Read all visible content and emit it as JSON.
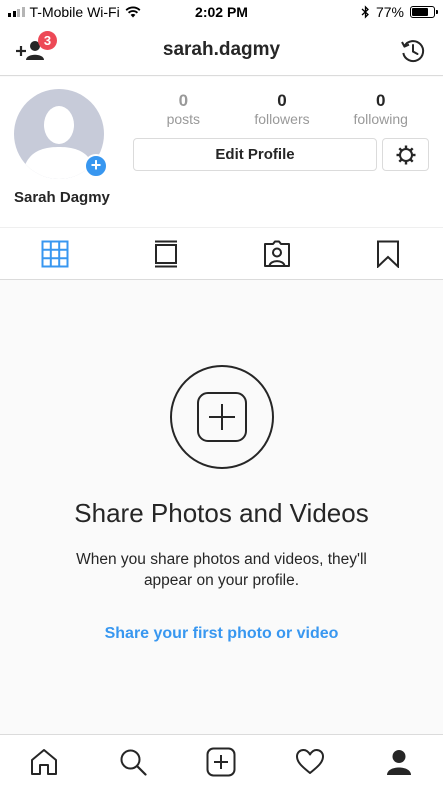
{
  "status_bar": {
    "carrier": "T-Mobile Wi-Fi",
    "time": "2:02 PM",
    "battery_percent": "77%",
    "battery_level": 0.77,
    "signal_bars": 2,
    "icons": [
      "signal-icon",
      "wifi-icon",
      "bluetooth-icon",
      "battery-icon"
    ]
  },
  "header": {
    "title": "sarah.dagmy",
    "notification_count": "3",
    "left_icon": "add-person-icon",
    "right_icon": "archive-history-icon"
  },
  "profile": {
    "name": "Sarah Dagmy",
    "stats": [
      {
        "value": "0",
        "label": "posts"
      },
      {
        "value": "0",
        "label": "followers"
      },
      {
        "value": "0",
        "label": "following"
      }
    ],
    "edit_button_label": "Edit Profile",
    "avatar_plus": "+"
  },
  "tabs": [
    {
      "icon": "grid-icon",
      "active": true
    },
    {
      "icon": "feed-icon",
      "active": false
    },
    {
      "icon": "tagged-icon",
      "active": false
    },
    {
      "icon": "saved-icon",
      "active": false
    }
  ],
  "empty_state": {
    "title": "Share Photos and Videos",
    "subtitle": "When you share photos and videos, they'll appear on your profile.",
    "link": "Share your first photo or video"
  },
  "bottom_nav": [
    {
      "icon": "home-icon"
    },
    {
      "icon": "search-icon"
    },
    {
      "icon": "new-post-icon"
    },
    {
      "icon": "activity-heart-icon"
    },
    {
      "icon": "profile-icon"
    }
  ],
  "colors": {
    "accent": "#3897f0",
    "badge": "#ed4956",
    "text": "#262626",
    "muted": "#999999",
    "border": "#dbdbdb"
  }
}
